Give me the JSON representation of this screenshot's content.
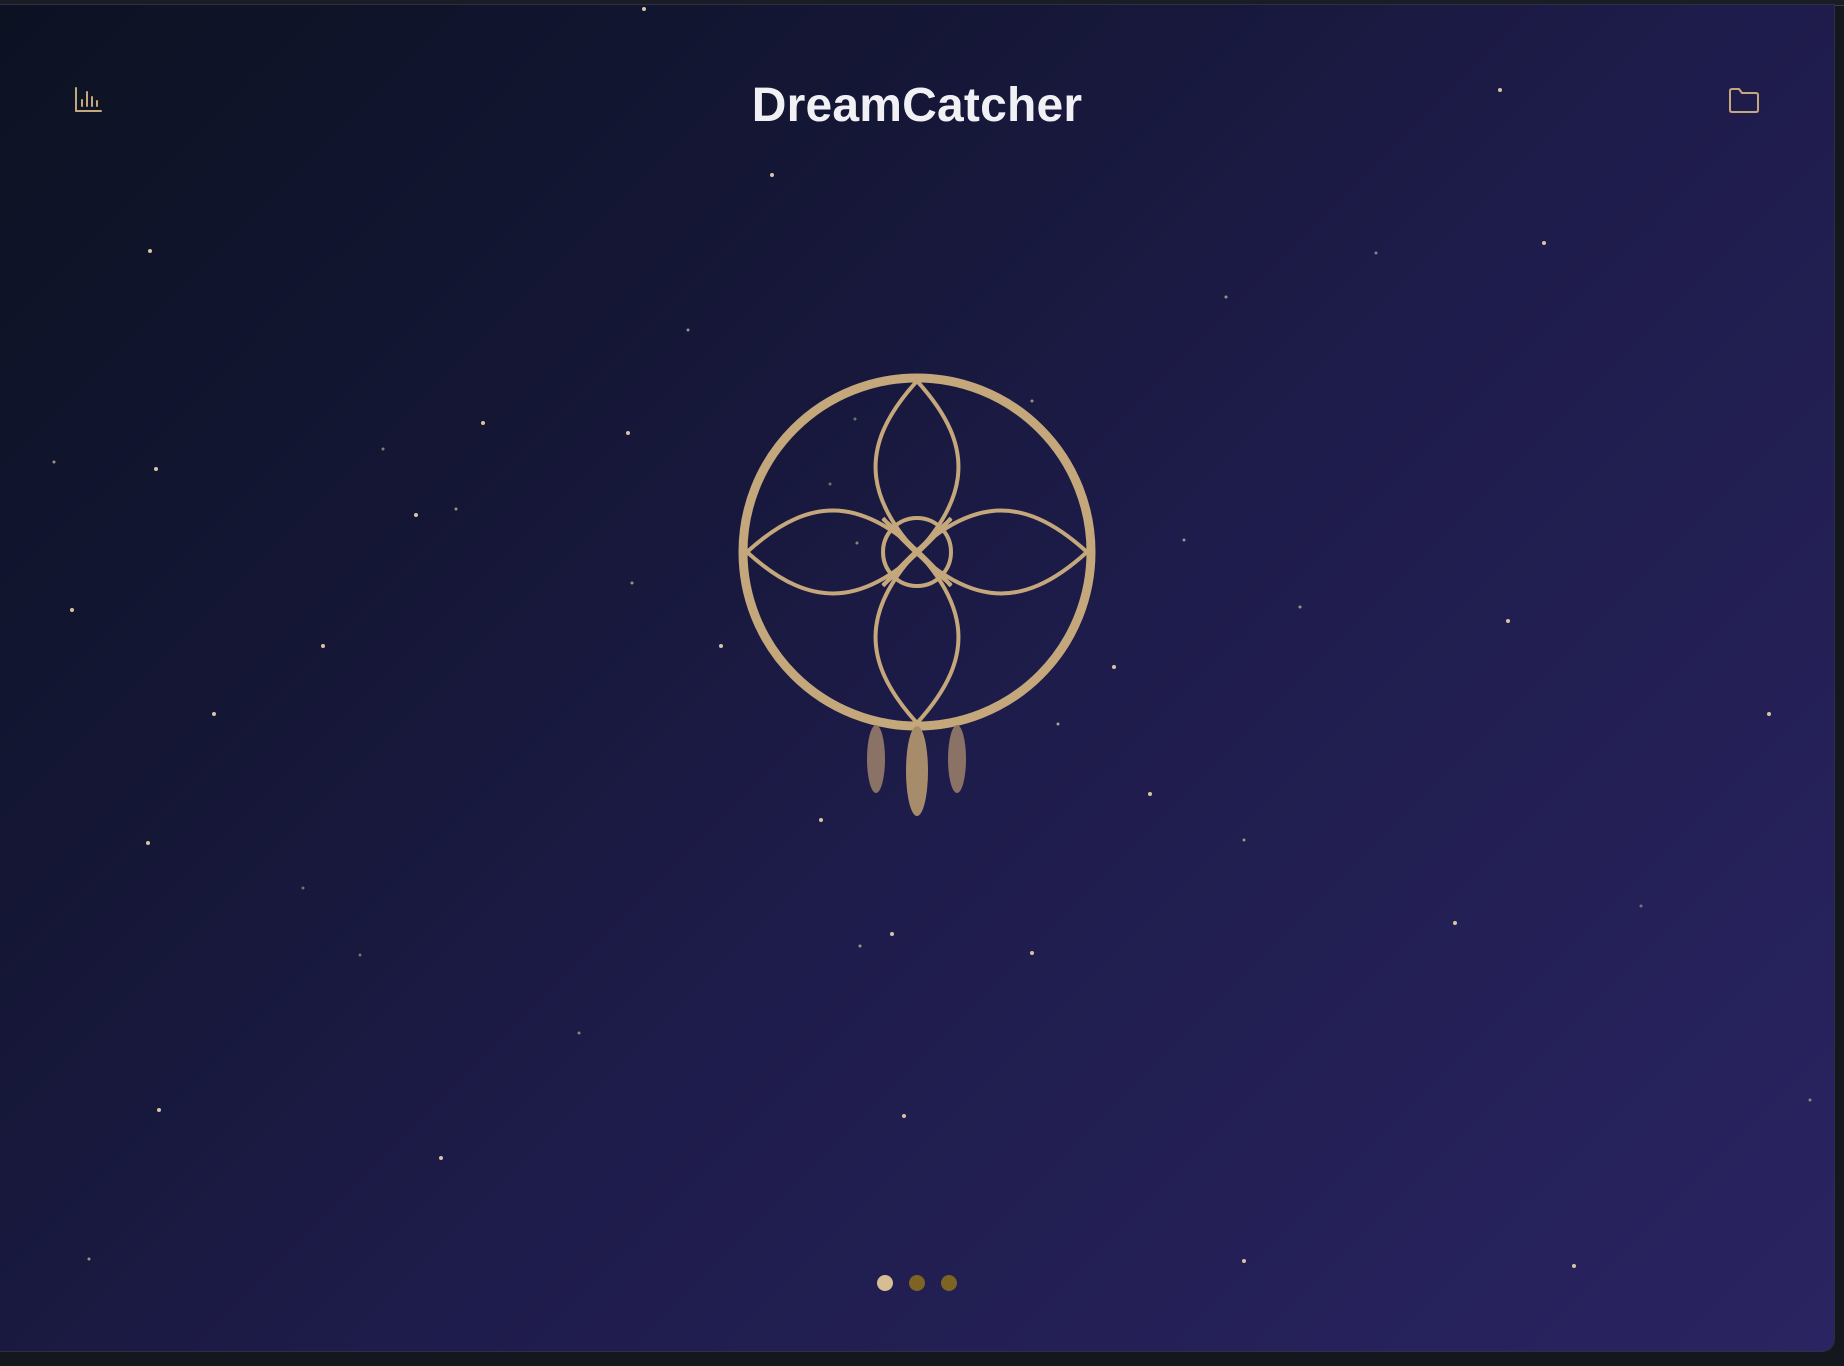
{
  "app": {
    "title": "DreamCatcher"
  },
  "header": {
    "left_icon": "bar-chart-icon",
    "right_icon": "folder-icon"
  },
  "pagination": {
    "total": 3,
    "active_index": 0
  },
  "colors": {
    "accent": "#c4a77a",
    "dot_active": "#d6bd92",
    "dot_inactive": "#7e6423",
    "feather_side": "#8a7366",
    "feather_center": "#a78c6c",
    "title": "#f1f1f5"
  }
}
